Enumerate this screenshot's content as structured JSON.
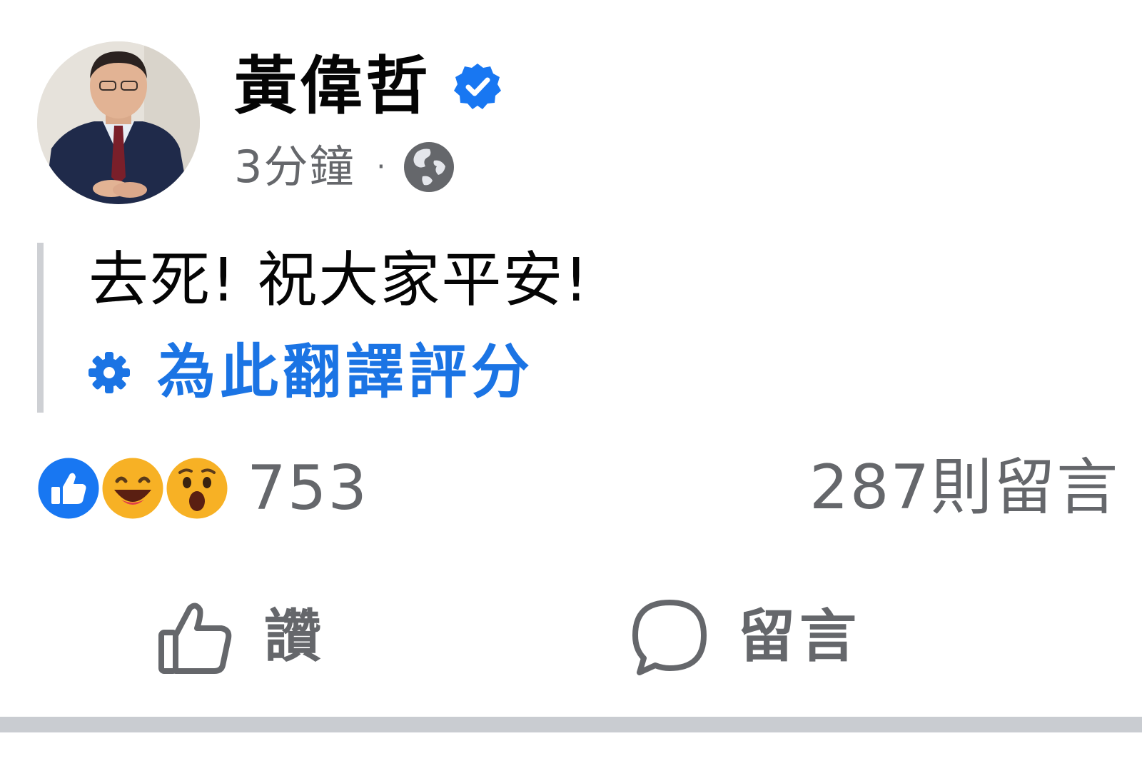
{
  "post": {
    "author": {
      "name": "黃偉哲",
      "verified_icon": "verified-badge-icon"
    },
    "meta": {
      "time": "3分鐘",
      "separator": "·",
      "audience_icon": "globe-icon"
    },
    "text": "去死! 祝大家平安!",
    "translate": {
      "icon": "gear-icon",
      "label": "為此翻譯評分"
    },
    "reactions": {
      "icons": [
        "like-reaction-icon",
        "haha-reaction-icon",
        "wow-reaction-icon"
      ],
      "count": "753"
    },
    "comments": {
      "count_label": "287則留言"
    },
    "actions": {
      "like_label": "讚",
      "comment_label": "留言"
    }
  },
  "colors": {
    "text": "#050505",
    "secondary": "#65676b",
    "accent": "#1b74e4",
    "verified": "#1877f2"
  }
}
